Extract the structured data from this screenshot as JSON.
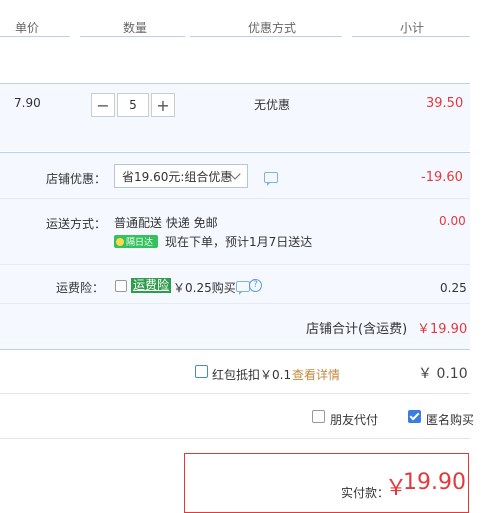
{
  "header": {
    "col_unit_price": "单价",
    "col_quantity": "数量",
    "col_discount": "优惠方式",
    "col_subtotal": "小计"
  },
  "item": {
    "unit_price": "7.90",
    "quantity": "5",
    "minus": "−",
    "plus": "+",
    "discount": "无优惠",
    "subtotal": "39.50"
  },
  "shop_discount": {
    "label": "店铺优惠：",
    "selected": "省19.60元:组合优惠",
    "amount": "-19.60"
  },
  "shipping": {
    "label": "运送方式：",
    "method": "普通配送 快递 免邮",
    "badge": "隔日达",
    "eta": "现在下单，预计1月7日送达",
    "amount": "0.00"
  },
  "insurance": {
    "label": "运费险：",
    "tag": "运费险",
    "price_text": "￥0.25购买",
    "amount": "0.25"
  },
  "shop_total": {
    "label": "店铺合计(含运费)",
    "amount": "￥19.90"
  },
  "redpacket": {
    "label": "红包抵扣￥0.1",
    "link": "查看详情",
    "amount": "￥ 0.10"
  },
  "options": {
    "friend_pay": "朋友代付",
    "anonymous": "匿名购买",
    "anonymous_checked": true
  },
  "payment": {
    "label": "实付款：",
    "currency": "￥",
    "amount": "19.90"
  },
  "colors": {
    "accent_red": "#e4393c",
    "row_bg": "#f5f9ff",
    "border_blue": "#b9d3ee",
    "badge_green": "#35c25e"
  }
}
